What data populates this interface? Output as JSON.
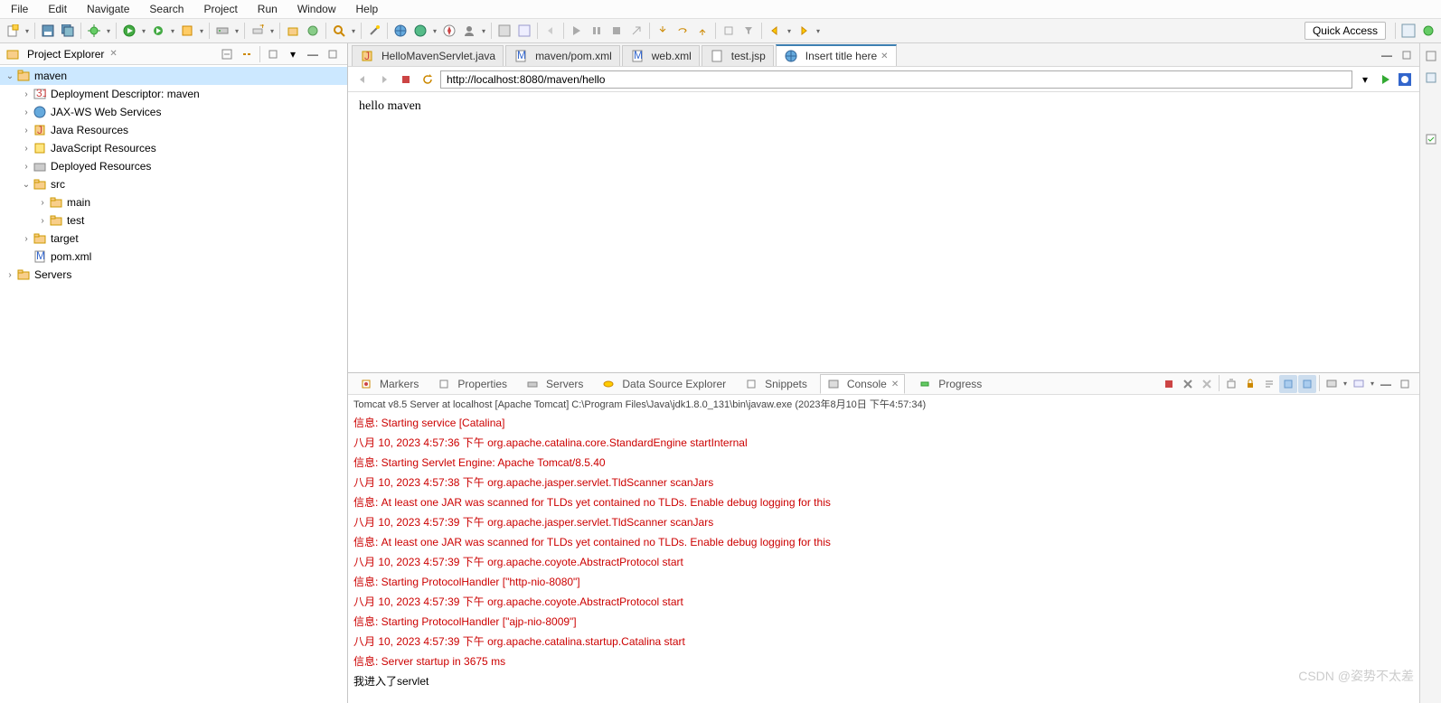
{
  "menu": [
    "File",
    "Edit",
    "Navigate",
    "Search",
    "Project",
    "Run",
    "Window",
    "Help"
  ],
  "quick_access": "Quick Access",
  "explorer": {
    "title": "Project Explorer",
    "items": [
      {
        "depth": 0,
        "arrow": "v",
        "icon": "project",
        "label": "maven",
        "sel": true
      },
      {
        "depth": 1,
        "arrow": ">",
        "icon": "dd",
        "label": "Deployment Descriptor: maven"
      },
      {
        "depth": 1,
        "arrow": ">",
        "icon": "jax",
        "label": "JAX-WS Web Services"
      },
      {
        "depth": 1,
        "arrow": ">",
        "icon": "java",
        "label": "Java Resources"
      },
      {
        "depth": 1,
        "arrow": ">",
        "icon": "js",
        "label": "JavaScript Resources"
      },
      {
        "depth": 1,
        "arrow": ">",
        "icon": "dep",
        "label": "Deployed Resources"
      },
      {
        "depth": 1,
        "arrow": "v",
        "icon": "folder",
        "label": "src"
      },
      {
        "depth": 2,
        "arrow": ">",
        "icon": "folder",
        "label": "main"
      },
      {
        "depth": 2,
        "arrow": ">",
        "icon": "folder",
        "label": "test"
      },
      {
        "depth": 1,
        "arrow": ">",
        "icon": "folder",
        "label": "target"
      },
      {
        "depth": 1,
        "arrow": "",
        "icon": "xml",
        "label": "pom.xml"
      },
      {
        "depth": 0,
        "arrow": ">",
        "icon": "folder",
        "label": "Servers"
      }
    ]
  },
  "tabs": [
    {
      "icon": "java",
      "label": "HelloMavenServlet.java",
      "active": false
    },
    {
      "icon": "xml",
      "label": "maven/pom.xml",
      "active": false
    },
    {
      "icon": "xml",
      "label": "web.xml",
      "active": false
    },
    {
      "icon": "jsp",
      "label": "test.jsp",
      "active": false
    },
    {
      "icon": "web",
      "label": "Insert title here",
      "active": true
    }
  ],
  "browser": {
    "url": "http://localhost:8080/maven/hello",
    "content": "hello maven"
  },
  "bottom_tabs": [
    {
      "label": "Markers",
      "active": false
    },
    {
      "label": "Properties",
      "active": false
    },
    {
      "label": "Servers",
      "active": false
    },
    {
      "label": "Data Source Explorer",
      "active": false
    },
    {
      "label": "Snippets",
      "active": false
    },
    {
      "label": "Console",
      "active": true
    },
    {
      "label": "Progress",
      "active": false
    }
  ],
  "console": {
    "title": "Tomcat v8.5 Server at localhost [Apache Tomcat] C:\\Program Files\\Java\\jdk1.8.0_131\\bin\\javaw.exe (2023年8月10日 下午4:57:34)",
    "lines": [
      {
        "c": "red",
        "t": "信息: Starting service [Catalina]"
      },
      {
        "c": "red",
        "t": "八月 10, 2023 4:57:36 下午 org.apache.catalina.core.StandardEngine startInternal"
      },
      {
        "c": "red",
        "t": "信息: Starting Servlet Engine: Apache Tomcat/8.5.40"
      },
      {
        "c": "red",
        "t": "八月 10, 2023 4:57:38 下午 org.apache.jasper.servlet.TldScanner scanJars"
      },
      {
        "c": "red",
        "t": "信息: At least one JAR was scanned for TLDs yet contained no TLDs. Enable debug logging for this"
      },
      {
        "c": "red",
        "t": "八月 10, 2023 4:57:39 下午 org.apache.jasper.servlet.TldScanner scanJars"
      },
      {
        "c": "red",
        "t": "信息: At least one JAR was scanned for TLDs yet contained no TLDs. Enable debug logging for this"
      },
      {
        "c": "red",
        "t": "八月 10, 2023 4:57:39 下午 org.apache.coyote.AbstractProtocol start"
      },
      {
        "c": "red",
        "t": "信息: Starting ProtocolHandler [\"http-nio-8080\"]"
      },
      {
        "c": "red",
        "t": "八月 10, 2023 4:57:39 下午 org.apache.coyote.AbstractProtocol start"
      },
      {
        "c": "red",
        "t": "信息: Starting ProtocolHandler [\"ajp-nio-8009\"]"
      },
      {
        "c": "red",
        "t": "八月 10, 2023 4:57:39 下午 org.apache.catalina.startup.Catalina start"
      },
      {
        "c": "red",
        "t": "信息: Server startup in 3675 ms"
      },
      {
        "c": "blk",
        "t": "我进入了servlet"
      }
    ]
  },
  "watermark": "CSDN @姿势不太差"
}
